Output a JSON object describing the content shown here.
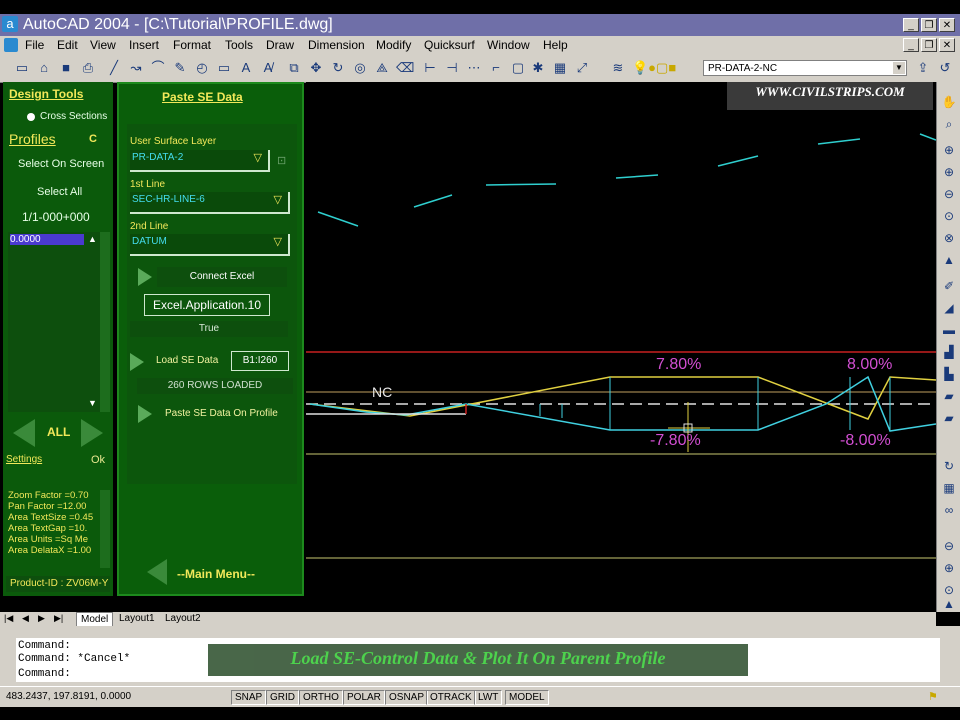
{
  "window": {
    "title": "AutoCAD 2004 - [C:\\Tutorial\\PROFILE.dwg]"
  },
  "menu": [
    "File",
    "Edit",
    "View",
    "Insert",
    "Format",
    "Tools",
    "Draw",
    "Dimension",
    "Modify",
    "Quicksurf",
    "Window",
    "Help"
  ],
  "toolbar": {
    "layer": "PR-DATA-2-NC"
  },
  "panel_left": {
    "design_tools": "Design Tools",
    "cross_sections": "Cross Sections",
    "profiles": "Profiles",
    "profiles_key": "C",
    "select_on_screen": "Select On Screen",
    "select_all": "Select All",
    "station": "1/1-000+000",
    "list_value": "0.0000",
    "all_label": "ALL",
    "settings": "Settings",
    "ok": "Ok",
    "params": [
      "Zoom Factor =0.70",
      "Pan Factor  =12.00",
      "Area TextSize =0.45",
      "Area TextGap  =10.",
      "Area Units  =Sq Me",
      "Area DelataX =1.00"
    ],
    "product_id": "Product-ID : ZV06M-Y"
  },
  "panel_se": {
    "title": "Paste SE Data",
    "user_surface_label": "User Surface Layer",
    "user_surface_value": "PR-DATA-2",
    "line1_label": "1st Line",
    "line1_value": "SEC-HR-LINE-6",
    "line2_label": "2nd Line",
    "line2_value": "DATUM",
    "connect_excel": "Connect Excel",
    "excel_app": "Excel.Application.10",
    "true_label": "True",
    "load_se": "Load SE Data",
    "range": "B1:I260",
    "rows_loaded": "260  ROWS  LOADED",
    "paste_se": "Paste SE Data On Profile",
    "main_menu": "--Main Menu--"
  },
  "drawing": {
    "watermark": "WWW.CIVILSTRIPS.COM",
    "nc_label": "NC",
    "top_pct_1": "7.80%",
    "bottom_pct_1": "-7.80%",
    "top_pct_2": "8.00%",
    "bottom_pct_2": "-8.00%"
  },
  "tabs": [
    "Model",
    "Layout1",
    "Layout2"
  ],
  "command": {
    "lines": [
      "Command:",
      "Command: *Cancel*",
      "Command:"
    ],
    "banner": "Load SE-Control Data & Plot It On Parent Profile"
  },
  "status": {
    "coords": "483.2437, 197.8191, 0.0000",
    "buttons": [
      "SNAP",
      "GRID",
      "ORTHO",
      "POLAR",
      "OSNAP",
      "OTRACK",
      "LWT",
      "MODEL"
    ]
  },
  "colors": {
    "panel_green": "#0a5e0a",
    "titlebar": "#6f6fa8",
    "magenta_text": "#d24fd2"
  }
}
